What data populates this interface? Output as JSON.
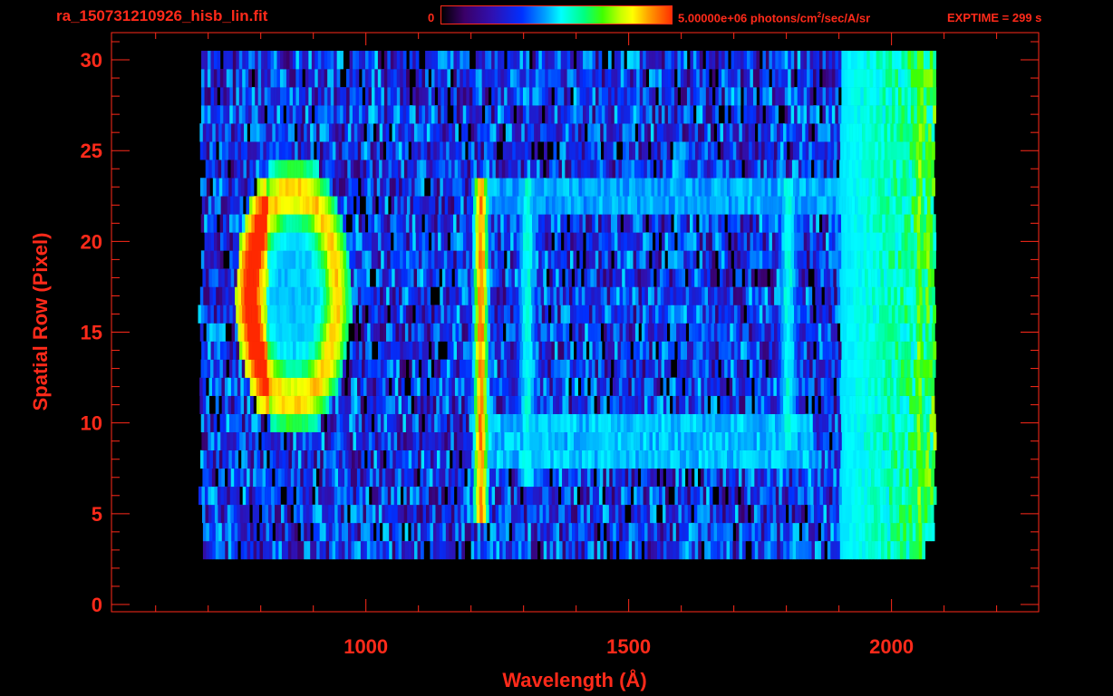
{
  "header": {
    "file_title": "ra_150731210926_hisb_lin.fit",
    "colorbar_min": "0",
    "colorbar_max_prefix": "5.00000e+06 photons/cm",
    "colorbar_max_sup": "2",
    "colorbar_max_suffix": "/sec/A/sr",
    "exptime": "EXPTIME = 299 s"
  },
  "colors": {
    "accent": "#ff2a1a",
    "background": "#000000"
  },
  "chart_data": {
    "type": "heatmap",
    "title": "ra_150731210926_hisb_lin.fit",
    "xlabel": "Wavelength (Å)",
    "ylabel": "Spatial Row (Pixel)",
    "xlim": [
      516,
      2280
    ],
    "ylim": [
      -0.4,
      31.5
    ],
    "xticks": [
      1000,
      1500,
      2000
    ],
    "yticks": [
      0,
      5,
      10,
      15,
      20,
      25,
      30
    ],
    "xticks_labels": [
      "1000",
      "1500",
      "2000"
    ],
    "yticks_labels": [
      "0",
      "5",
      "10",
      "15",
      "20",
      "25",
      "30"
    ],
    "colorbar": {
      "min": 0,
      "max": 5000000,
      "units": "photons/cm^2/sec/A/sr"
    },
    "data_extent": {
      "x": [
        690,
        2080
      ],
      "rows": [
        3,
        30
      ]
    },
    "features": [
      {
        "name": "emission ring",
        "wavelength_range": [
          760,
          960
        ],
        "rows": [
          10,
          24
        ],
        "peak_fraction": 1.0
      },
      {
        "name": "emission line",
        "wavelength": 1216,
        "rows": [
          5,
          23
        ],
        "peak_fraction": 0.88
      },
      {
        "name": "emission line",
        "wavelength": 1304,
        "rows": [
          7,
          23
        ],
        "peak_fraction": 0.5
      },
      {
        "name": "emission band",
        "wavelength": 1800,
        "rows": [
          9,
          23
        ],
        "peak_fraction": 0.5
      },
      {
        "name": "red edge",
        "wavelength": 2050,
        "rows": [
          3,
          30
        ],
        "peak_fraction": 0.7
      }
    ]
  }
}
